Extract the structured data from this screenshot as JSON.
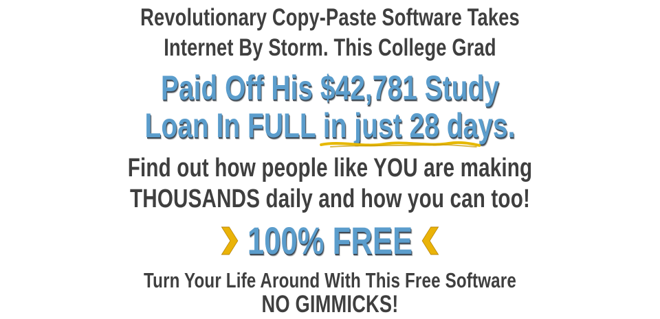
{
  "headline": {
    "line1": "Revolutionary Copy-Paste Software Takes",
    "line2": "Internet By Storm. This College Grad"
  },
  "highlight": {
    "line1": "Paid Off His $42,781 Study",
    "line2_prefix": "Loan In FULL ",
    "line2_underlined": "in just 28 days",
    "line2_suffix": "."
  },
  "find_out": {
    "line1": "Find out how people like YOU are making",
    "line2": "THOUSANDS daily and how you can too!"
  },
  "free_badge": {
    "label": "100% FREE",
    "left_icon": "chevron-right-icon",
    "right_icon": "chevron-left-icon"
  },
  "tagline": {
    "line1": "Turn Your Life Around With This Free Software",
    "line2": "NO GIMMICKS!"
  },
  "colors": {
    "text_gray": "#3f3f3f",
    "accent_blue": "#5b9dcc",
    "underline_yellow": "#e6b800",
    "chevron_yellow": "#eab308"
  }
}
